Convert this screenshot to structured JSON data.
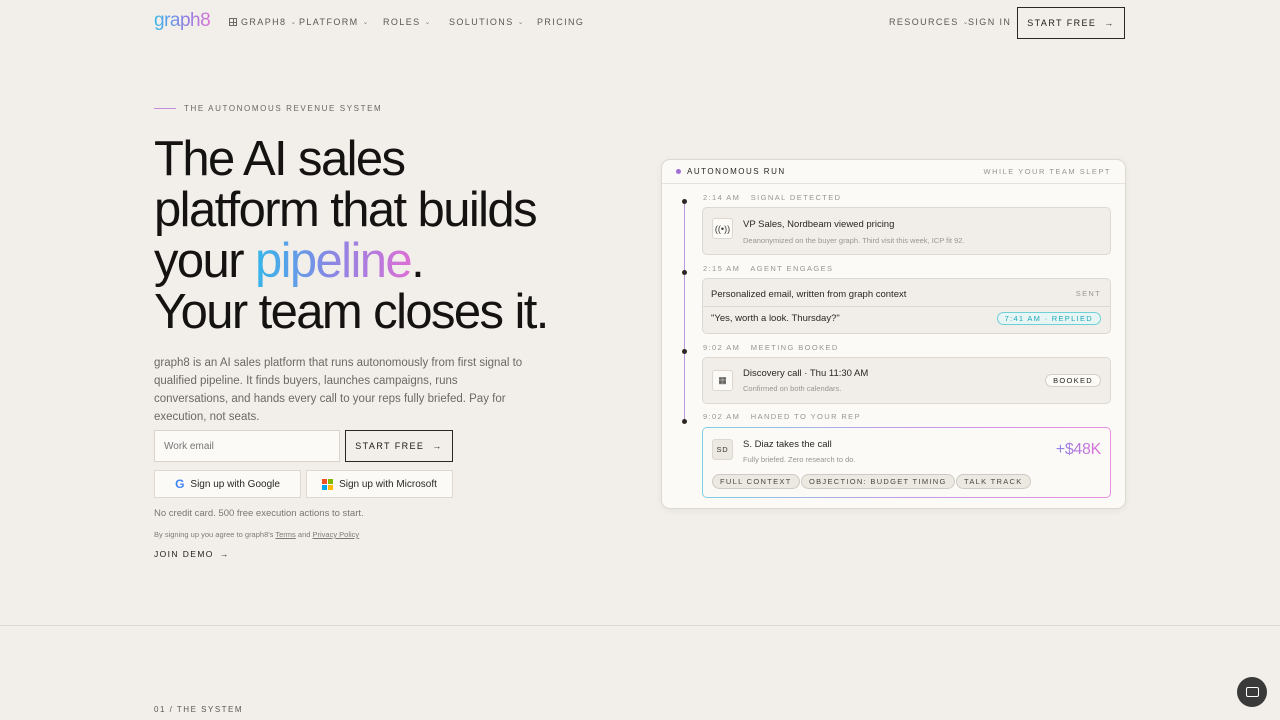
{
  "nav": {
    "logo": "graph8",
    "graph8_menu": "GRAPH8",
    "platform": "PLATFORM",
    "roles": "ROLES",
    "solutions": "SOLUTIONS",
    "pricing": "PRICING",
    "resources": "RESOURCES",
    "sign_in": "SIGN IN",
    "start_free": "START FREE"
  },
  "hero": {
    "eyebrow": "THE AUTONOMOUS REVENUE SYSTEM",
    "headline_1": "The AI sales",
    "headline_2": "platform that builds",
    "headline_3a": "your ",
    "headline_3_accent": "pipeline",
    "headline_3b": ".",
    "headline_4": "Your team closes it.",
    "description": "graph8 is an AI sales platform that runs autonomously from first signal to qualified pipeline. It finds buyers, launches campaigns, runs conversations, and hands every call to your reps fully briefed. Pay for execution, not seats.",
    "email_placeholder": "Work email",
    "start_free": "START FREE",
    "google_signup": "Sign up with Google",
    "microsoft_signup": "Sign up with Microsoft",
    "note": "No credit card. 500 free execution actions to start.",
    "legal_prefix": "By signing up you agree to graph8's ",
    "terms": "Terms",
    "legal_and": " and ",
    "privacy": "Privacy Policy",
    "join_demo": "JOIN DEMO"
  },
  "card": {
    "title": "AUTONOMOUS RUN",
    "subtitle": "WHILE YOUR TEAM SLEPT",
    "steps": [
      {
        "label": "2:14 AM   SIGNAL DETECTED",
        "title": "VP Sales, Nordbeam viewed pricing",
        "sub": "Deanonymized on the buyer graph. Third visit this week, ICP fit 92."
      },
      {
        "label": "2:15 AM   AGENT ENGAGES",
        "title": "Personalized email, written from graph context",
        "status": "SENT",
        "reply": "\"Yes, worth a look. Thursday?\"",
        "reply_badge": "7:41 AM · REPLIED"
      },
      {
        "label": "9:02 AM   MEETING BOOKED",
        "title": "Discovery call · Thu 11:30 AM",
        "sub": "Confirmed on both calendars.",
        "badge": "BOOKED"
      },
      {
        "label": "9:02 AM   HANDED TO YOUR REP",
        "initials": "SD",
        "title": "S. Diaz takes the call",
        "sub": "Fully briefed. Zero research to do.",
        "amount": "+$48K",
        "tags": [
          "FULL CONTEXT",
          "OBJECTION: BUDGET TIMING",
          "TALK TRACK"
        ]
      }
    ]
  },
  "section": {
    "label": "01 / THE SYSTEM"
  },
  "colors": {
    "accent_purple": "#9e6fd4",
    "gradient_start": "#35b6ea",
    "gradient_end": "#dd6fd6",
    "reply_teal": "#1aa9b8"
  }
}
